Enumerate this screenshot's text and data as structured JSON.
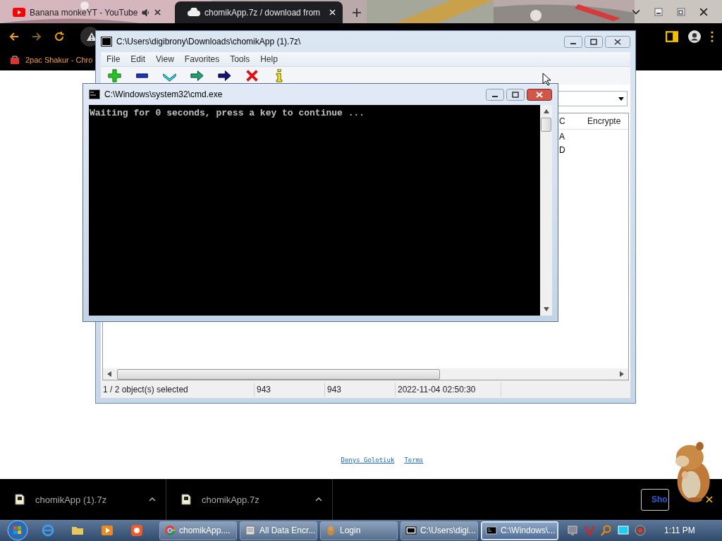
{
  "browser": {
    "tabs": [
      {
        "title": "Banana monkeYT - YouTube",
        "selected": false
      },
      {
        "title": "chomikApp.7z / download from",
        "selected": true
      }
    ],
    "bookmarks": [
      "2pac Shakur - Chro"
    ]
  },
  "page": {
    "footer_links": [
      "Denys Golotiuk",
      "Terms"
    ]
  },
  "archive_window": {
    "title": "C:\\Users\\digibrony\\Downloads\\chomikApp (1).7z\\",
    "menu": [
      "File",
      "Edit",
      "View",
      "Favorites",
      "Tools",
      "Help"
    ],
    "columns": [
      "C",
      "Encrypte"
    ],
    "rows": [
      {
        "cells": [
          "A",
          ""
        ],
        "selected": false
      },
      {
        "cells": [
          "D",
          ""
        ],
        "selected": false
      }
    ],
    "status": [
      "1 / 2 object(s) selected",
      "943",
      "943",
      "2022-11-04 02:50:30"
    ]
  },
  "console_window": {
    "title": "C:\\Windows\\system32\\cmd.exe",
    "lines": [
      "Waiting for 0 seconds, press a key to continue ..."
    ]
  },
  "downloads": {
    "items": [
      "chomikApp (1).7z",
      "chomikApp.7z"
    ],
    "show_button": "Sho"
  },
  "taskbar": {
    "buttons": [
      {
        "label": "chomikApp....",
        "kind": "chrome",
        "selected": false
      },
      {
        "label": "All Data Encr...",
        "kind": "doc",
        "selected": false
      },
      {
        "label": "Login",
        "kind": "hamster",
        "selected": false
      },
      {
        "label": "C:\\Users\\digi...",
        "kind": "sevenzip",
        "selected": false
      },
      {
        "label": "C:\\Windows\\...",
        "kind": "console",
        "selected": true
      }
    ],
    "clock": "1:11 PM"
  }
}
